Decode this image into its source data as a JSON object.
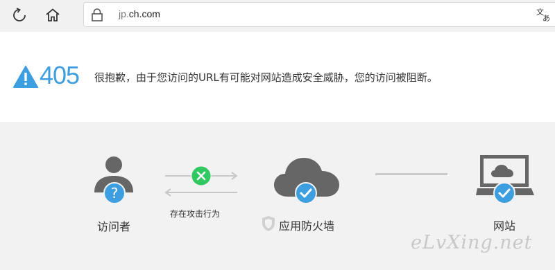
{
  "browser": {
    "url_prefix": "jp.",
    "url_domain": "ch.com",
    "icons": [
      "reload-icon",
      "home-icon",
      "lock-icon",
      "translate-icon"
    ]
  },
  "error": {
    "code": "405",
    "message": "很抱歉，由于您访问的URL有可能对网站造成安全威胁，您的访问被阻断。",
    "icon": "warning-icon"
  },
  "flow": {
    "visitor_label": "访问者",
    "attack_label": "存在攻击行为",
    "firewall_label": "应用防火墙",
    "website_label": "网站"
  },
  "watermark": "eLvXing.net",
  "colors": {
    "accent_blue": "#3d9ee0",
    "check_blue": "#4a9fdf",
    "x_green": "#2fc861",
    "gray_icon": "#666666",
    "page_gray": "#f2f2f2"
  }
}
